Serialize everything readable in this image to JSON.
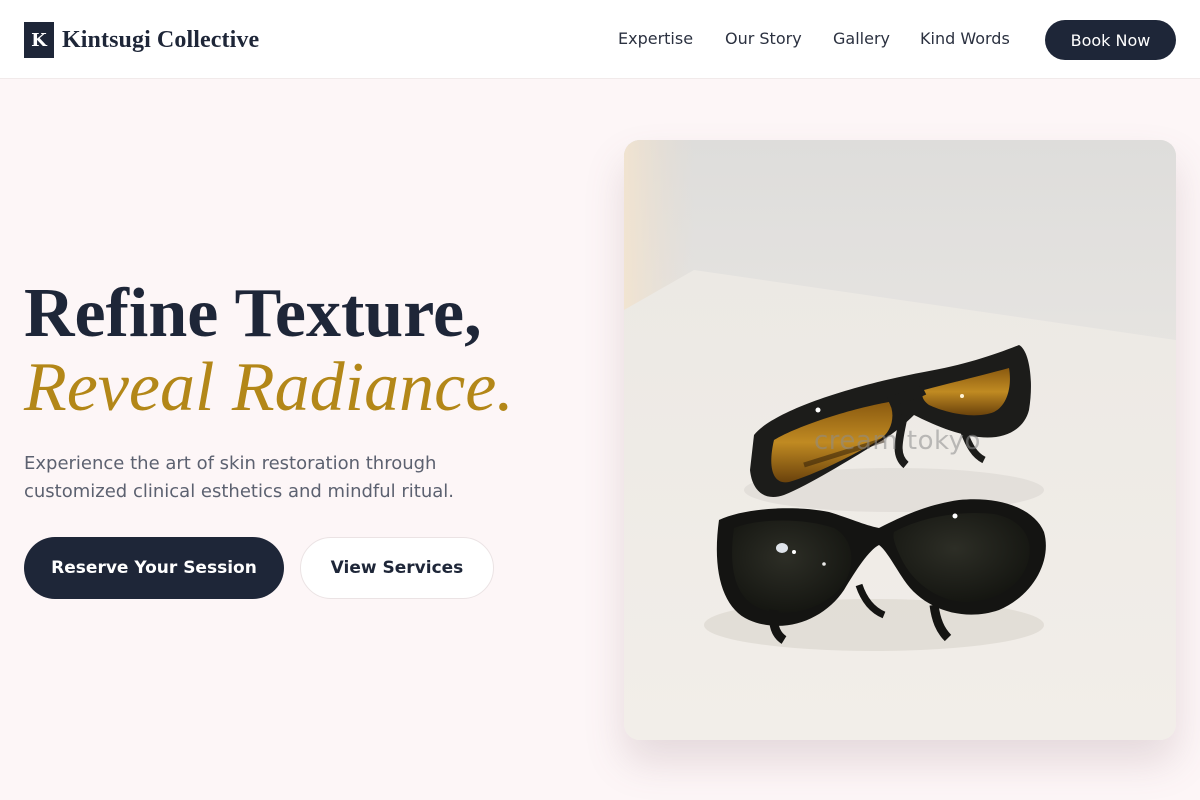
{
  "brand": {
    "mark": "K",
    "name": "Kintsugi Collective"
  },
  "nav": {
    "links": [
      "Expertise",
      "Our Story",
      "Gallery",
      "Kind Words"
    ],
    "cta": "Book Now"
  },
  "hero": {
    "title": "Refine Texture,",
    "title_accent": "Reveal Radiance.",
    "subtitle": "Experience the art of skin restoration through customized clinical esthetics and mindful ritual.",
    "primary_button": "Reserve Your Session",
    "secondary_button": "View Services",
    "image": {
      "watermark": "cream tokyo"
    }
  },
  "colors": {
    "navy": "#1e2638",
    "gold": "#b38718",
    "page_background": "#fdf6f7"
  }
}
